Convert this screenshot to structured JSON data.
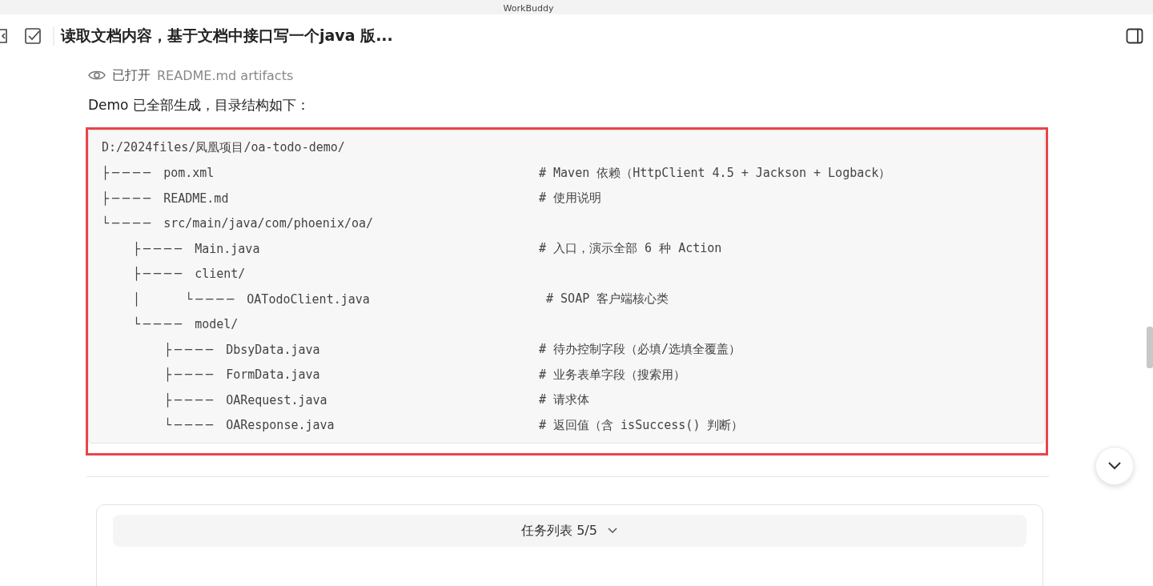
{
  "window": {
    "title": "WorkBuddy"
  },
  "header": {
    "title": "读取文档内容，基于文档中接口写一个java 版..."
  },
  "opened": {
    "label": "已打开",
    "files": "README.md  artifacts"
  },
  "message": "Demo 已全部生成，目录结构如下：",
  "code_block": {
    "highlighted": true,
    "root": "D:/2024files/凤凰项目/oa-todo-demo/",
    "tree": [
      {
        "branch": "├────",
        "name": "pom.xml",
        "comment": "# Maven 依赖（HttpClient 4.5 + Jackson + Logback）"
      },
      {
        "branch": "├────",
        "name": "README.md",
        "comment": "# 使用说明"
      },
      {
        "branch": "└────",
        "name": "src/main/java/com/phoenix/oa/",
        "children": [
          {
            "branch": "├────",
            "name": "Main.java",
            "comment": "# 入口，演示全部 6 种 Action"
          },
          {
            "branch": "├────",
            "name": "client/",
            "children": [
              {
                "branch": "│    └────",
                "name": "OATodoClient.java",
                "comment": " # SOAP 客户端核心类"
              }
            ]
          },
          {
            "branch": "└────",
            "name": "model/",
            "children": [
              {
                "branch": "├────",
                "name": "DbsyData.java",
                "comment": "# 待办控制字段（必填/选填全覆盖）"
              },
              {
                "branch": "├────",
                "name": "FormData.java",
                "comment": "# 业务表单字段（搜索用）"
              },
              {
                "branch": "├────",
                "name": "OARequest.java",
                "comment": "# 请求体"
              },
              {
                "branch": "└────",
                "name": "OAResponse.java",
                "comment": "# 返回值（含 isSuccess() 判断）"
              }
            ]
          }
        ]
      }
    ]
  },
  "task_panel": {
    "label": "任务列表 5/5",
    "expanded": false
  }
}
